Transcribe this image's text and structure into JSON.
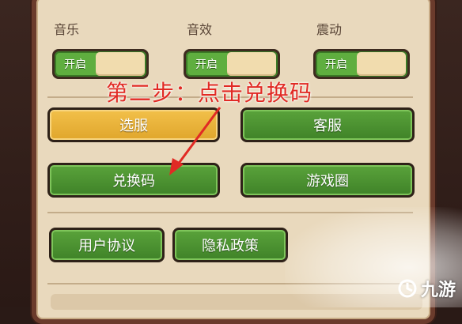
{
  "settings": {
    "music": {
      "label": "音乐",
      "toggle_text": "开启"
    },
    "sound": {
      "label": "音效",
      "toggle_text": "开启"
    },
    "vibration": {
      "label": "震动",
      "toggle_text": "开启"
    }
  },
  "buttons": {
    "select_server": "选服",
    "customer_service": "客服",
    "redeem_code": "兑换码",
    "game_circle": "游戏圈",
    "user_agreement": "用户协议",
    "privacy_policy": "隐私政策"
  },
  "annotation": {
    "text": "第二步：点击兑换码",
    "color": "#e12a24"
  },
  "watermark": {
    "text": "九游"
  },
  "colors": {
    "panel_bg": "#e9d9bd",
    "frame": "#6b3b2c",
    "button_green": "#4a932f",
    "button_yellow": "#e9b33a",
    "toggle_green": "#5fae3f"
  }
}
